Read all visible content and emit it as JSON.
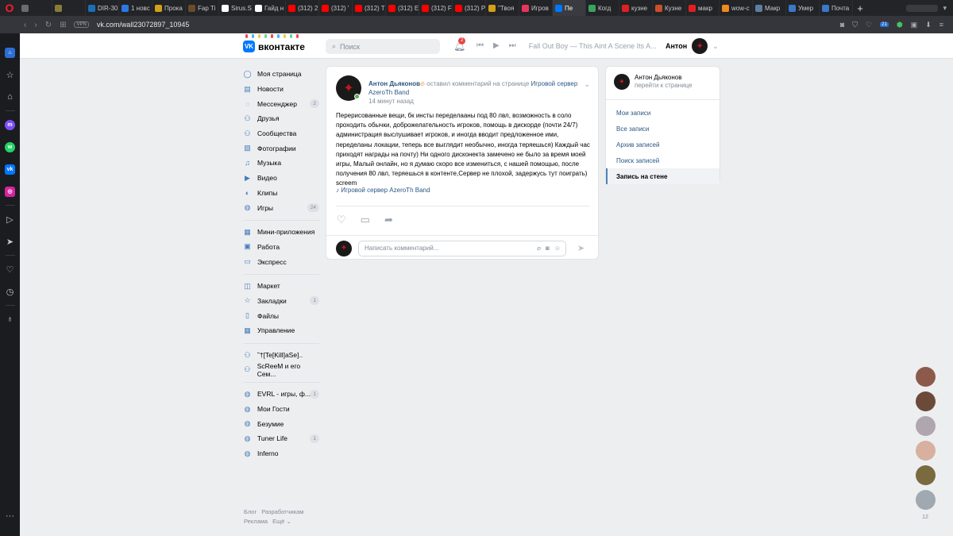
{
  "browser": {
    "tabs": [
      {
        "label": "",
        "color": "#6b6b6b"
      },
      {
        "label": "",
        "color": "#8a7b3a"
      },
      {
        "label": "DIR-30",
        "color": "#1b6fb8"
      },
      {
        "label": "1 новс",
        "color": "#2a7ae2"
      },
      {
        "label": "Прока",
        "color": "#d4a017"
      },
      {
        "label": "Fap Ti",
        "color": "#6a4c2b"
      },
      {
        "label": "Sirus.S",
        "color": "#ffffff"
      },
      {
        "label": "Гайд н",
        "color": "#ffffff"
      },
      {
        "label": "(312) 2",
        "color": "#ff0000"
      },
      {
        "label": "(312) '",
        "color": "#ff0000"
      },
      {
        "label": "(312) T",
        "color": "#ff0000"
      },
      {
        "label": "(312) E",
        "color": "#ff0000"
      },
      {
        "label": "(312) F",
        "color": "#ff0000"
      },
      {
        "label": "(312) P",
        "color": "#ff0000"
      },
      {
        "label": "\"Твоя",
        "color": "#d4a017"
      },
      {
        "label": "Игров",
        "color": "#e8355c"
      },
      {
        "label": "Пе",
        "color": "#0077ff",
        "active": true
      },
      {
        "label": "Когд",
        "color": "#3aa35f"
      },
      {
        "label": "кузне",
        "color": "#e02020"
      },
      {
        "label": "Кузне",
        "color": "#c8502a"
      },
      {
        "label": "макр",
        "color": "#e02020"
      },
      {
        "label": "wow-c",
        "color": "#f08a1c"
      },
      {
        "label": "Макр",
        "color": "#5b7fa3"
      },
      {
        "label": "Умер",
        "color": "#3a78c8"
      },
      {
        "label": "Почта",
        "color": "#3a78c8"
      }
    ],
    "url": "vk.com/wall23072897_10945",
    "vpn": "VPN",
    "ext_count": "21"
  },
  "opera_sidebar": {
    "icons": [
      "home-icon",
      "bookmark-icon",
      "history-icon",
      "messenger-icon",
      "whatsapp-icon",
      "vk-icon",
      "instagram-icon",
      "player-icon",
      "send-icon",
      "heart-icon",
      "clock-icon",
      "bulb-icon",
      "more-icon"
    ]
  },
  "header": {
    "logo": "вконтакте",
    "search_placeholder": "Поиск",
    "notifications": "2",
    "track": "Fall Out Boy — This Aint A Scene Its A...",
    "user_name": "Антон"
  },
  "nav": {
    "group1": [
      {
        "label": "Моя страница",
        "icon": "user-icon",
        "count": ""
      },
      {
        "label": "Новости",
        "icon": "news-icon",
        "count": ""
      },
      {
        "label": "Мессенджер",
        "icon": "messenger-icon",
        "count": "2"
      },
      {
        "label": "Друзья",
        "icon": "friends-icon",
        "count": ""
      },
      {
        "label": "Сообщества",
        "icon": "communities-icon",
        "count": ""
      },
      {
        "label": "Фотографии",
        "icon": "photos-icon",
        "count": ""
      },
      {
        "label": "Музыка",
        "icon": "music-icon",
        "count": ""
      },
      {
        "label": "Видео",
        "icon": "video-icon",
        "count": ""
      },
      {
        "label": "Клипы",
        "icon": "clips-icon",
        "count": ""
      },
      {
        "label": "Игры",
        "icon": "games-icon",
        "count": "24"
      }
    ],
    "group2": [
      {
        "label": "Мини-приложения",
        "icon": "apps-icon",
        "count": ""
      },
      {
        "label": "Работа",
        "icon": "work-icon",
        "count": ""
      },
      {
        "label": "Экспресс",
        "icon": "express-icon",
        "count": ""
      }
    ],
    "group3": [
      {
        "label": "Маркет",
        "icon": "market-icon",
        "count": ""
      },
      {
        "label": "Закладки",
        "icon": "bookmarks-icon",
        "count": "1"
      },
      {
        "label": "Файлы",
        "icon": "files-icon",
        "count": ""
      },
      {
        "label": "Управление",
        "icon": "manage-icon",
        "count": ""
      }
    ],
    "group4": [
      {
        "label": "˜†[Te[Kill]aSe]..",
        "icon": "group-icon",
        "count": ""
      },
      {
        "label": "ScReeM и его Сем...",
        "icon": "group-icon",
        "count": ""
      }
    ],
    "group5": [
      {
        "label": "EVRL - игры, ф...",
        "icon": "app-icon",
        "count": "1"
      },
      {
        "label": "Мои Гости",
        "icon": "app-icon",
        "count": ""
      },
      {
        "label": "Безумие",
        "icon": "app-icon",
        "count": ""
      },
      {
        "label": "Tuner Life",
        "icon": "app-icon",
        "count": "1"
      },
      {
        "label": "Inferno",
        "icon": "app-icon",
        "count": ""
      }
    ],
    "footer": [
      "Блог",
      "Разработчикам",
      "Реклама",
      "Ещё ⌄"
    ]
  },
  "post": {
    "author": "Антон Дьяконов",
    "action": " оставил комментарий на странице ",
    "target": "Игровой сервер AzeroTh Band",
    "time": "14 минут назад",
    "text": "Перерисованные вещи, бк инсты переделааны под 80 лвл, возможность в соло проходить обычки, доброжелательность игроков, помощь в дискорде (почти 24/7) администрация выслушивает игроков, и иногда вводит предложенное ими, переделаны локации, теперь все выглядит необычно, иногда теряешься) Каждый час приходят награды на почту) Ни одного дисконекта замечено не было за время моей игры, Малый онлайн, но я думаю скоро все измениться, с нашей помощью, после получения 80 лвл, теряешься в контенте,Сервер не плохой, задержусь тут поиграть) screem",
    "source": "Игровой сервер AzeroTh Band",
    "comment_placeholder": "Написать комментарий..."
  },
  "right": {
    "name": "Антон Дьяконов",
    "sub": "перейти к странице",
    "menu": [
      {
        "label": "Мои записи",
        "active": false
      },
      {
        "label": "Все записи",
        "active": false
      },
      {
        "label": "Архив записей",
        "active": false
      },
      {
        "label": "Поиск записей",
        "active": false
      },
      {
        "label": "Запись на стене",
        "active": true
      }
    ]
  },
  "friends": {
    "count": "12",
    "avatar_colors": [
      "#8c5a4a",
      "#6b4a3a",
      "#b0a6b0",
      "#d8b0a0",
      "#7a6a40",
      "#a0a8b0"
    ]
  },
  "colors": {
    "accent": "#2a5885",
    "vk_blue": "#0077ff",
    "badge_red": "#e64646"
  }
}
